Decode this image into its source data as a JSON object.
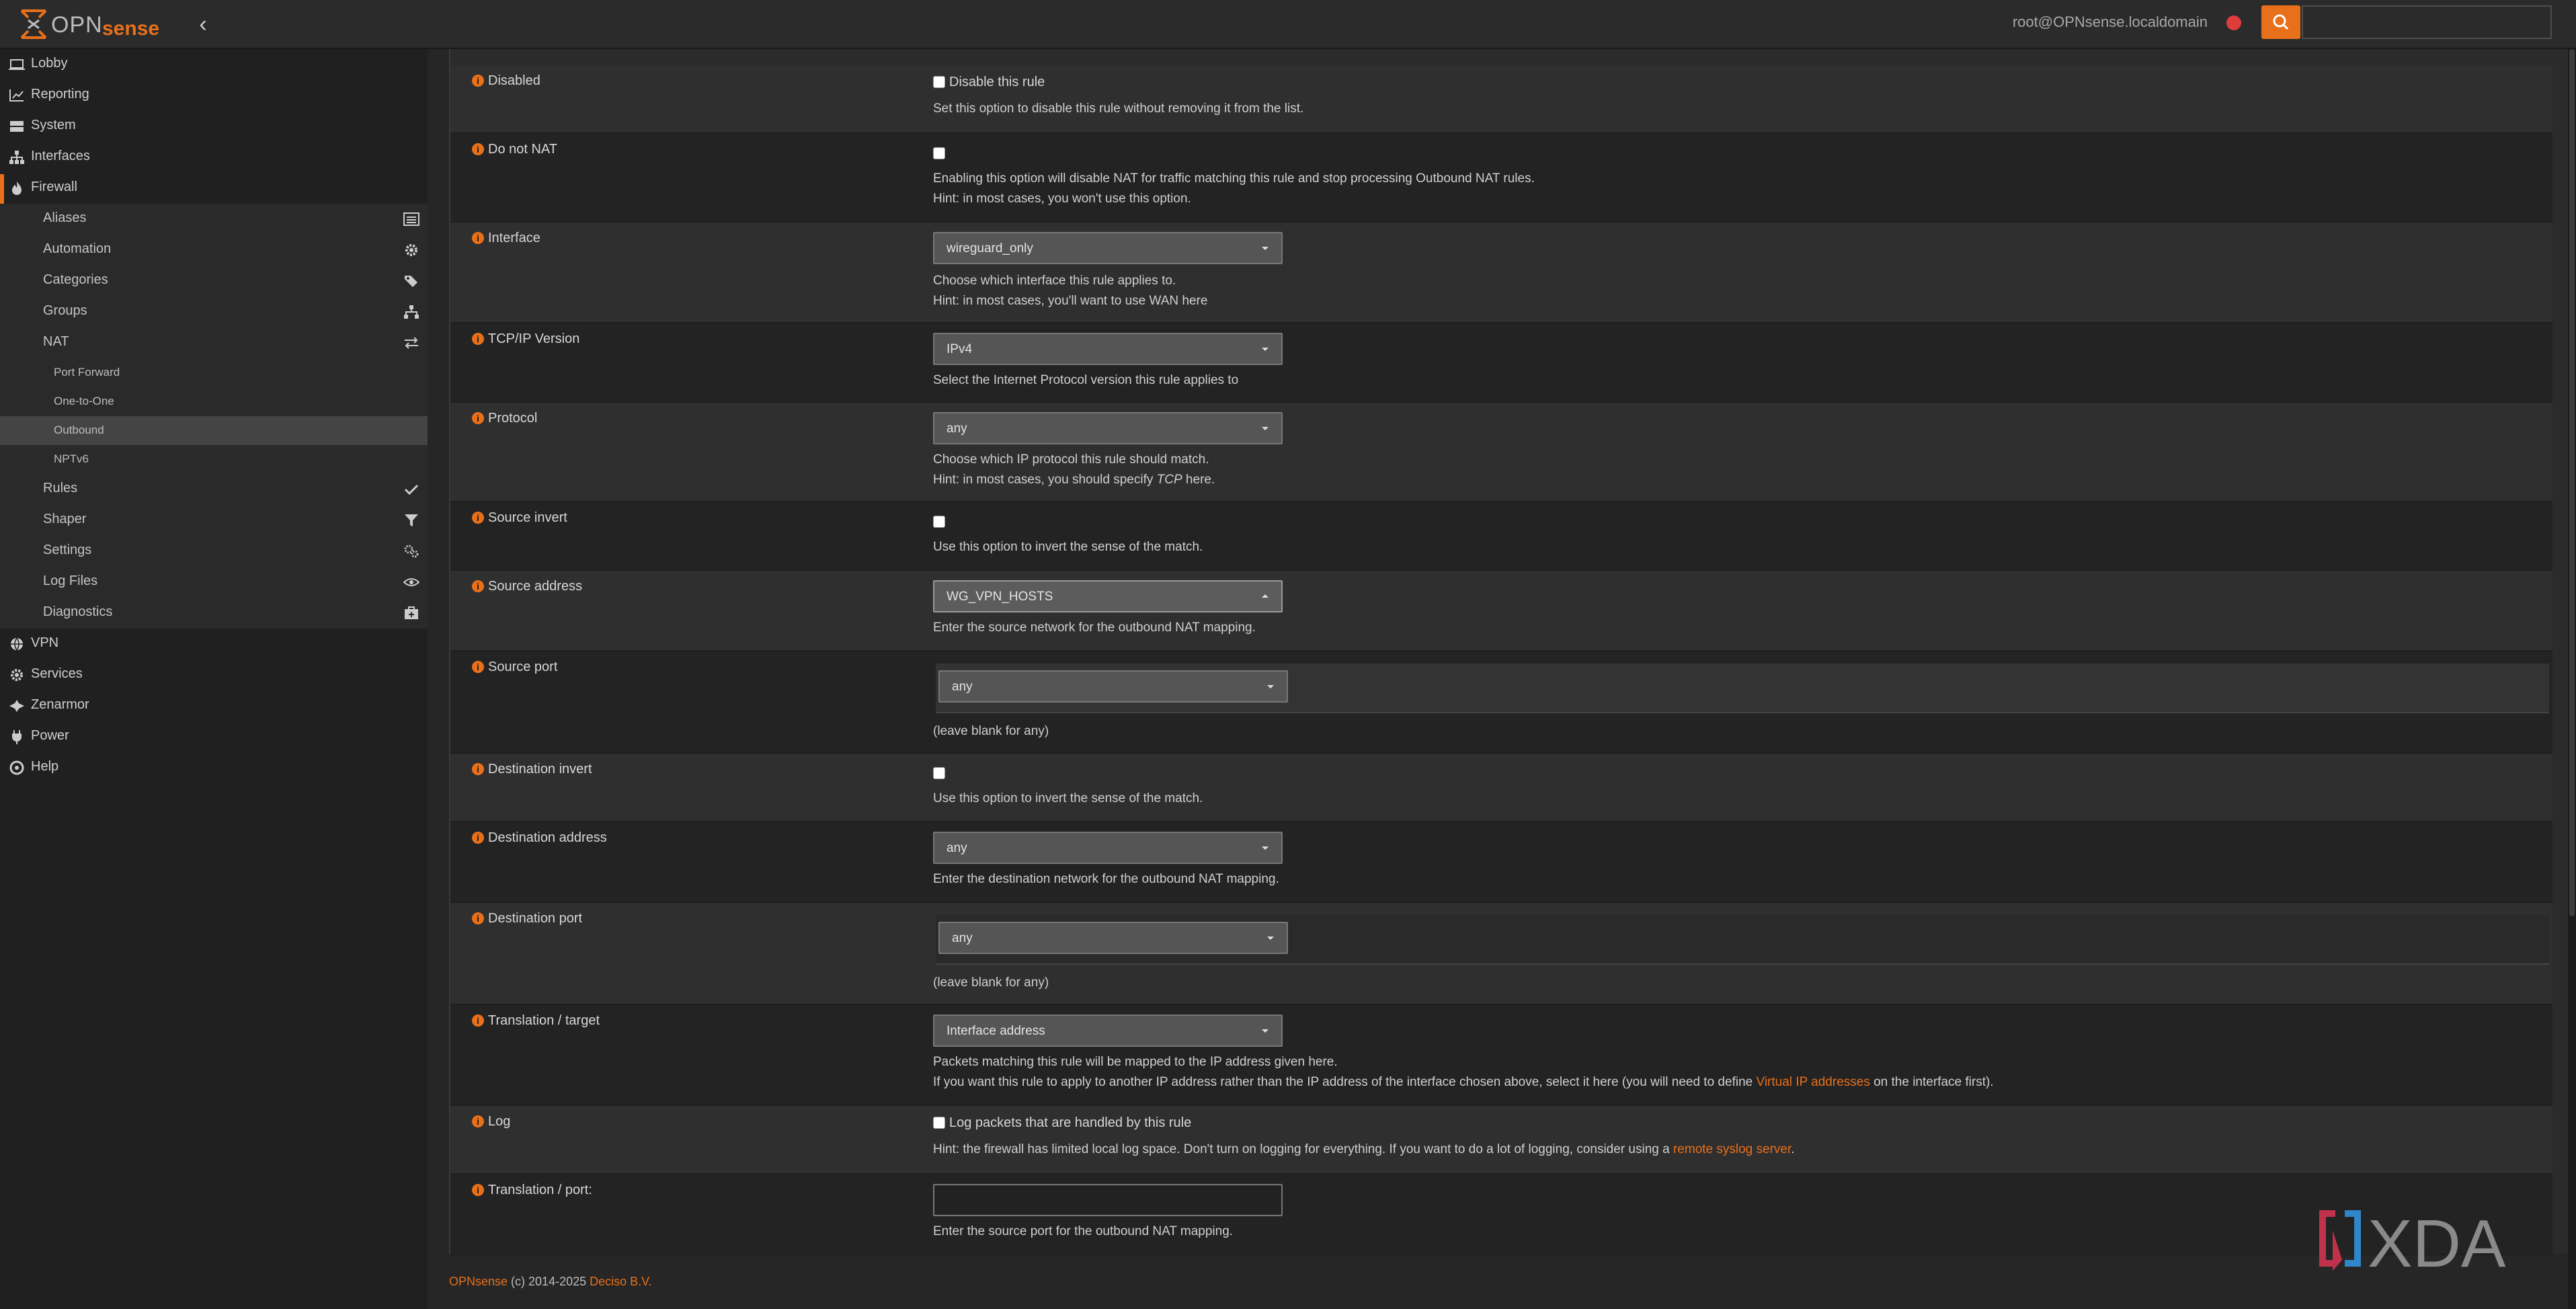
{
  "header": {
    "brand": "OPNsense",
    "user": "root@OPNsense.localdomain",
    "search": {
      "value": "",
      "placeholder": ""
    }
  },
  "sidebar": {
    "items": [
      {
        "label": "Lobby",
        "icon": "laptop-icon"
      },
      {
        "label": "Reporting",
        "icon": "chart-icon"
      },
      {
        "label": "System",
        "icon": "server-icon"
      },
      {
        "label": "Interfaces",
        "icon": "sitemap-icon"
      },
      {
        "label": "Firewall",
        "icon": "fire-icon"
      }
    ],
    "firewall_sub": [
      {
        "label": "Aliases",
        "icon": "list-icon"
      },
      {
        "label": "Automation",
        "icon": "gear-icon"
      },
      {
        "label": "Categories",
        "icon": "tags-icon"
      },
      {
        "label": "Groups",
        "icon": "sitemap-icon"
      },
      {
        "label": "NAT",
        "icon": "exchange-icon"
      }
    ],
    "nat_sub": [
      "Port Forward",
      "One-to-One",
      "Outbound",
      "NPTv6"
    ],
    "firewall_sub2": [
      {
        "label": "Rules",
        "icon": "check-icon"
      },
      {
        "label": "Shaper",
        "icon": "filter-icon"
      },
      {
        "label": "Settings",
        "icon": "gears-icon"
      },
      {
        "label": "Log Files",
        "icon": "eye-icon"
      },
      {
        "label": "Diagnostics",
        "icon": "medkit-icon"
      }
    ],
    "bottom_items": [
      {
        "label": "VPN",
        "icon": "globe-icon"
      },
      {
        "label": "Services",
        "icon": "gear-icon"
      },
      {
        "label": "Zenarmor",
        "icon": "zenarmor-icon"
      },
      {
        "label": "Power",
        "icon": "plug-icon"
      },
      {
        "label": "Help",
        "icon": "help-icon"
      }
    ]
  },
  "form": {
    "disabled": {
      "label": "Disabled",
      "check_label": "Disable this rule",
      "help": "Set this option to disable this rule without removing it from the list."
    },
    "no_nat": {
      "label": "Do not NAT",
      "help1": "Enabling this option will disable NAT for traffic matching this rule and stop processing Outbound NAT rules.",
      "help2": "Hint: in most cases, you won't use this option."
    },
    "interface": {
      "label": "Interface",
      "value": "wireguard_only",
      "help1": "Choose which interface this rule applies to.",
      "help2": "Hint: in most cases, you'll want to use WAN here"
    },
    "tcpip": {
      "label": "TCP/IP Version",
      "value": "IPv4",
      "help": "Select the Internet Protocol version this rule applies to"
    },
    "protocol": {
      "label": "Protocol",
      "value": "any",
      "help1": "Choose which IP protocol this rule should match.",
      "help2a": "Hint: in most cases, you should specify ",
      "help2b": "TCP",
      "help2c": " here."
    },
    "source_invert": {
      "label": "Source invert",
      "help": "Use this option to invert the sense of the match."
    },
    "source_address": {
      "label": "Source address",
      "value": "WG_VPN_HOSTS",
      "help": "Enter the source network for the outbound NAT mapping."
    },
    "source_port": {
      "label": "Source port",
      "value": "any",
      "help": "(leave blank for any)"
    },
    "dest_invert": {
      "label": "Destination invert",
      "help": "Use this option to invert the sense of the match."
    },
    "dest_address": {
      "label": "Destination address",
      "value": "any",
      "help": "Enter the destination network for the outbound NAT mapping."
    },
    "dest_port": {
      "label": "Destination port",
      "value": "any",
      "help": "(leave blank for any)"
    },
    "translation": {
      "label": "Translation / target",
      "value": "Interface address",
      "help1": "Packets matching this rule will be mapped to the IP address given here.",
      "help2a": "If you want this rule to apply to another IP address rather than the IP address of the interface chosen above, select it here (you will need to define ",
      "help2_link": "Virtual IP addresses",
      "help2b": " on the interface first)."
    },
    "log": {
      "label": "Log",
      "check_label": "Log packets that are handled by this rule",
      "help_a": "Hint: the firewall has limited local log space. Don't turn on logging for everything. If you want to do a lot of logging, consider using a ",
      "help_link": "remote syslog server",
      "help_b": "."
    },
    "translation_port": {
      "label": "Translation / port:",
      "value": "",
      "help": "Enter the source port for the outbound NAT mapping."
    }
  },
  "footer": {
    "brand": "OPNsense",
    "copy": " (c) 2014-2025 ",
    "company": "Deciso B.V."
  },
  "watermark": {
    "text": "XDA"
  },
  "colors": {
    "accent": "#e8701a",
    "background": "#262626",
    "alert_dot": "#e03c3c"
  }
}
